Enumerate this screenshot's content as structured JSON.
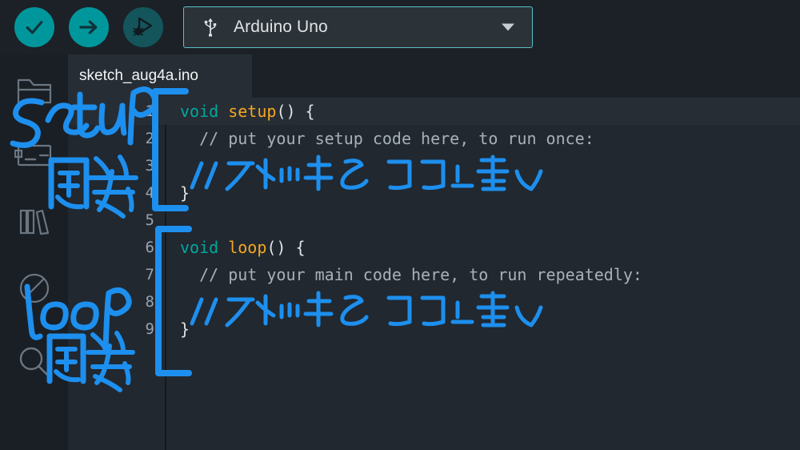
{
  "window": {
    "background_color": "#1c2127",
    "editor_background_color": "#212830"
  },
  "toolbar": {
    "verify_button": {
      "label": "Verify",
      "icon": "check-icon",
      "color": "#00979c"
    },
    "upload_button": {
      "label": "Upload",
      "icon": "arrow-right-icon",
      "color": "#00979c"
    },
    "debug_button": {
      "label": "Debug",
      "icon": "debug-play-bug-icon",
      "color": "#14555c"
    },
    "board_selector": {
      "icon": "usb-icon",
      "value": "Arduino Uno",
      "caret": "chevron-down-icon",
      "border_color": "#5bc0c4"
    }
  },
  "sidebar": {
    "items": [
      {
        "name": "sketchbook",
        "icon": "folder-icon"
      },
      {
        "name": "boards-manager",
        "icon": "board-chip-icon"
      },
      {
        "name": "library-manager",
        "icon": "books-icon"
      },
      {
        "name": "debug",
        "icon": "circle-slash-icon"
      },
      {
        "name": "search",
        "icon": "search-icon"
      }
    ]
  },
  "tabs": [
    {
      "label": "sketch_aug4a.ino",
      "active": true
    }
  ],
  "editor": {
    "lines": [
      {
        "number": "1",
        "active": true,
        "tokens": [
          {
            "text": "void ",
            "type": "type"
          },
          {
            "text": "setup",
            "type": "fn"
          },
          {
            "text": "() {",
            "type": "punct"
          }
        ]
      },
      {
        "number": "2",
        "active": false,
        "tokens": [
          {
            "text": "  // put your setup code here, to run once:",
            "type": "comment"
          }
        ]
      },
      {
        "number": "3",
        "active": false,
        "tokens": []
      },
      {
        "number": "4",
        "active": false,
        "tokens": [
          {
            "text": "}",
            "type": "punct"
          }
        ]
      },
      {
        "number": "5",
        "active": false,
        "tokens": []
      },
      {
        "number": "6",
        "active": false,
        "tokens": [
          {
            "text": "void ",
            "type": "type"
          },
          {
            "text": "loop",
            "type": "fn"
          },
          {
            "text": "() {",
            "type": "punct"
          }
        ]
      },
      {
        "number": "7",
        "active": false,
        "tokens": [
          {
            "text": "  // put your main code here, to run repeatedly:",
            "type": "comment"
          }
        ]
      },
      {
        "number": "8",
        "active": false,
        "tokens": []
      },
      {
        "number": "9",
        "active": false,
        "tokens": [
          {
            "text": "}",
            "type": "punct"
          }
        ]
      }
    ]
  },
  "annotations": {
    "ink_color": "#1d8fee",
    "items": [
      {
        "name": "setup-function-label",
        "text": "setup 関数",
        "line1": "setup",
        "line2": "関数"
      },
      {
        "name": "loop-function-label",
        "text": "loop 関数",
        "line1": "loop",
        "line2": "関数"
      },
      {
        "name": "setup-comment-handwritten",
        "text": "// スケッチをココに書く"
      },
      {
        "name": "loop-comment-handwritten",
        "text": "// スケッチをココに書く"
      }
    ]
  }
}
